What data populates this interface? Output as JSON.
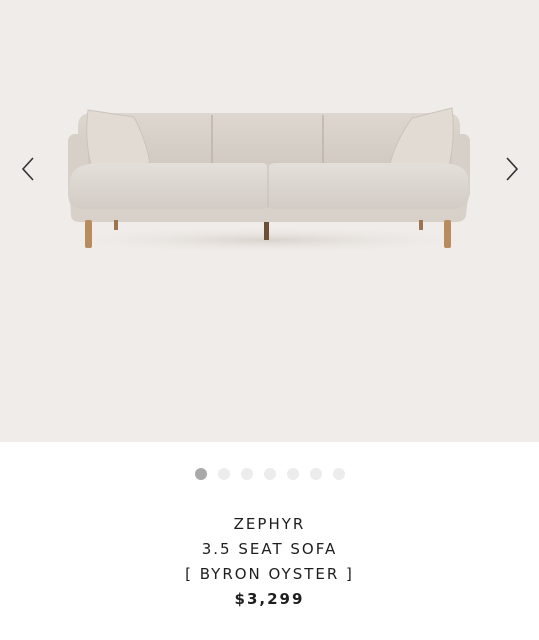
{
  "gallery": {
    "image_alt": "sofa",
    "prev_icon": "chevron-left-icon",
    "next_icon": "chevron-right-icon",
    "slide_count": 7,
    "active_slide": 1,
    "colors": {
      "background": "#f0ece9",
      "fabric": "#dcd6cf",
      "legs": "#b98c5f",
      "dot_active": "#a9a9a9",
      "dot_inactive": "#ececec"
    }
  },
  "product": {
    "brand": "ZEPHYR",
    "name": "3.5 SEAT SOFA",
    "variant": "[ BYRON OYSTER ]",
    "price": "$3,299"
  }
}
